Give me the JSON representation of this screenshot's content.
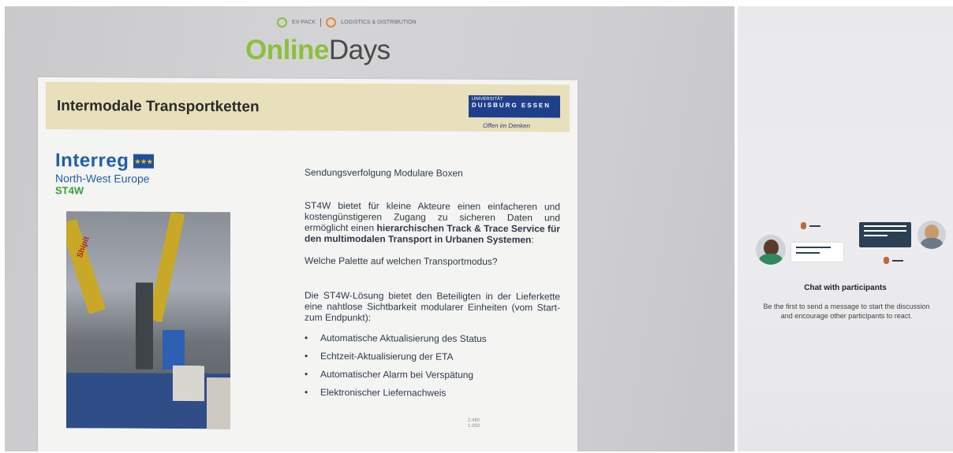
{
  "header": {
    "brand_left": "EX-PACK",
    "brand_right": "LOGISTICS & DISTRIBUTION",
    "title_online": "Online",
    "title_days": "Days"
  },
  "slide": {
    "title": "Intermodale Transportketten",
    "university": {
      "small": "UNIVERSITÄT",
      "name": "DUISBURG ESSEN",
      "slogan": "Offen im Denken"
    },
    "interreg": {
      "name": "Interreg",
      "region": "North-West Europe",
      "project": "ST4W"
    },
    "photo_label": "Shipit",
    "heading": "Sendungsverfolgung Modulare Boxen",
    "para1_pre": "ST4W bietet für kleine Akteure einen einfacheren und kostengünstigeren Zugang zu sicheren Daten und ermöglicht einen ",
    "para1_bold": "hierarchischen Track & Trace Service für den multimodalen Transport in Urbanen Systemen",
    "para1_post": ":",
    "question": "Welche Palette auf welchen Transportmodus?",
    "para2": "Die ST4W-Lösung bietet den Beteiligten in der Lieferkette eine nahtlose Sichtbarkeit modularer Einheiten (vom Start- zum Endpunkt):",
    "bullets": [
      "Automatische Aktualisierung des Status",
      "Echtzeit-Aktualisierung der ETA",
      "Automatischer Alarm bei Verspätung",
      "Elektronischer Liefernachweis"
    ],
    "stamp_top": "2.480",
    "stamp_bottom": "1.050"
  },
  "chat": {
    "title": "Chat with participants",
    "line1": "Be the first to send a message to start the discussion",
    "line2": "and encourage other participants to react."
  }
}
